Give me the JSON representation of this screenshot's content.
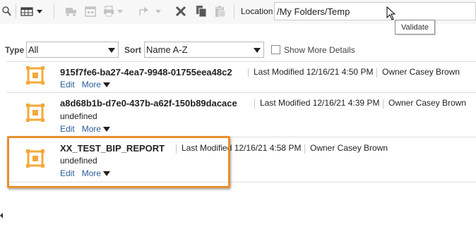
{
  "toolbar": {
    "location_label": "Location",
    "location_value": "/My Folders/Temp",
    "tooltip": "Validate"
  },
  "filter": {
    "type_label": "Type",
    "type_value": "All",
    "sort_label": "Sort",
    "sort_value": "Name A-Z",
    "show_more_label": "Show More Details",
    "show_more_checked": false
  },
  "items": [
    {
      "name": "915f7fe6-ba27-4ea7-9948-01755eea48c2",
      "modified": "Last Modified 12/16/21 4:50 PM",
      "owner": "Owner Casey Brown",
      "description": "",
      "edit": "Edit",
      "more": "More"
    },
    {
      "name": "a8d68b1b-d7e0-437b-a62f-150b89dacace",
      "modified": "Last Modified 12/16/21 4:39 PM",
      "owner": "Owner Casey Brown",
      "description": "undefined",
      "edit": "Edit",
      "more": "More"
    },
    {
      "name": "XX_TEST_BIP_REPORT",
      "modified": "Last Modified 12/16/21 4:58 PM",
      "owner": "Owner Casey Brown",
      "description": "undefined",
      "edit": "Edit",
      "more": "More"
    }
  ],
  "colors": {
    "highlight": "#e8902e",
    "icon": "#f4a93a",
    "link": "#2a5d99"
  }
}
